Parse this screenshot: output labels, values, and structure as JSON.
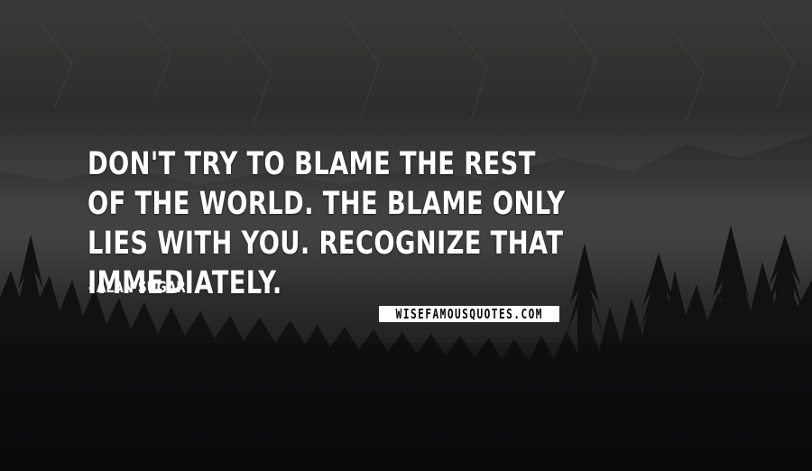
{
  "quote": {
    "text": "DON'T TRY TO BLAME THE REST OF THE WORLD. THE BLAME ONLY LIES WITH YOU. RECOGNIZE THAT IMMEDIATELY."
  },
  "author": {
    "dash": "-",
    "name": "ALAN SUGAR"
  },
  "watermark": {
    "text": "WISEFAMOUSQUOTES.COM"
  },
  "colors": {
    "text": "#ffffff",
    "background": "#232425",
    "watermark_bg": "#ffffff",
    "watermark_text": "#000000"
  }
}
